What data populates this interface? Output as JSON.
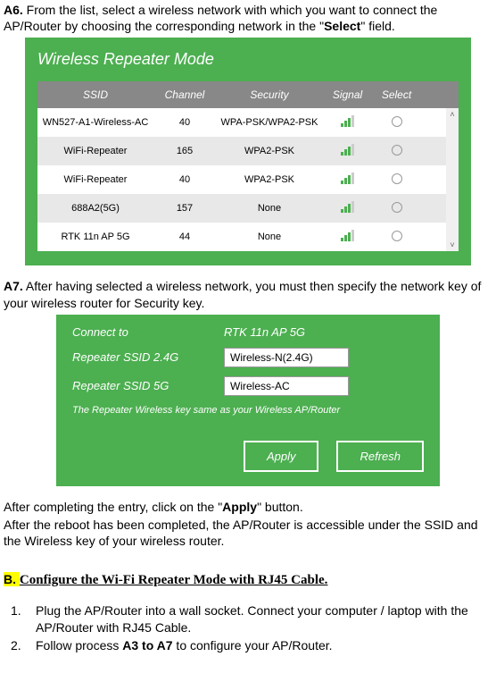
{
  "stepA6": {
    "prefix": "A6.",
    "text_before": " From the list, select a wireless network with which you want to connect the AP/Router by choosing the corresponding network in the \"",
    "select_word": "Select",
    "text_after": "\" field."
  },
  "screenshot1": {
    "title": "Wireless Repeater Mode",
    "headers": {
      "ssid": "SSID",
      "channel": "Channel",
      "security": "Security",
      "signal": "Signal",
      "select": "Select"
    },
    "rows": [
      {
        "ssid": "WN527-A1-Wireless-AC",
        "channel": "40",
        "security": "WPA-PSK/WPA2-PSK"
      },
      {
        "ssid": "WiFi-Repeater",
        "channel": "165",
        "security": "WPA2-PSK"
      },
      {
        "ssid": "WiFi-Repeater",
        "channel": "40",
        "security": "WPA2-PSK"
      },
      {
        "ssid": "688A2(5G)",
        "channel": "157",
        "security": "None"
      },
      {
        "ssid": "RTK 11n AP 5G",
        "channel": "44",
        "security": "None"
      }
    ],
    "scroll_up": "˄",
    "scroll_down": "˅"
  },
  "stepA7": {
    "prefix": "A7.",
    "text": " After having selected a wireless network, you must then specify the network key of your wireless router for Security key."
  },
  "screenshot2": {
    "connect_label": "Connect to",
    "connect_value": "RTK 11n AP 5G",
    "ssid24_label": "Repeater SSID 2.4G",
    "ssid24_value": "Wireless-N(2.4G)",
    "ssid5_label": "Repeater SSID 5G",
    "ssid5_value": "Wireless-AC",
    "note": "The Repeater Wireless key same as your Wireless AP/Router",
    "apply_btn": "Apply",
    "refresh_btn": "Refresh"
  },
  "after_text": {
    "line1_before": "After completing the entry, click on the \"",
    "apply_word": "Apply",
    "line1_after": "\" button.",
    "line2": "After the reboot has been completed, the AP/Router is accessible under the SSID and the Wireless key of your wireless router."
  },
  "sectionB": {
    "prefix": "B. ",
    "heading": "Configure the Wi-Fi Repeater Mode with RJ45 Cable."
  },
  "list": {
    "item1_num": "1.",
    "item1_text": "Plug the AP/Router into a wall socket. Connect your computer / laptop with the AP/Router with RJ45 Cable.",
    "item2_num": "2.",
    "item2_before": "Follow process ",
    "item2_bold": "A3 to A7",
    "item2_after": " to configure your AP/Router."
  }
}
